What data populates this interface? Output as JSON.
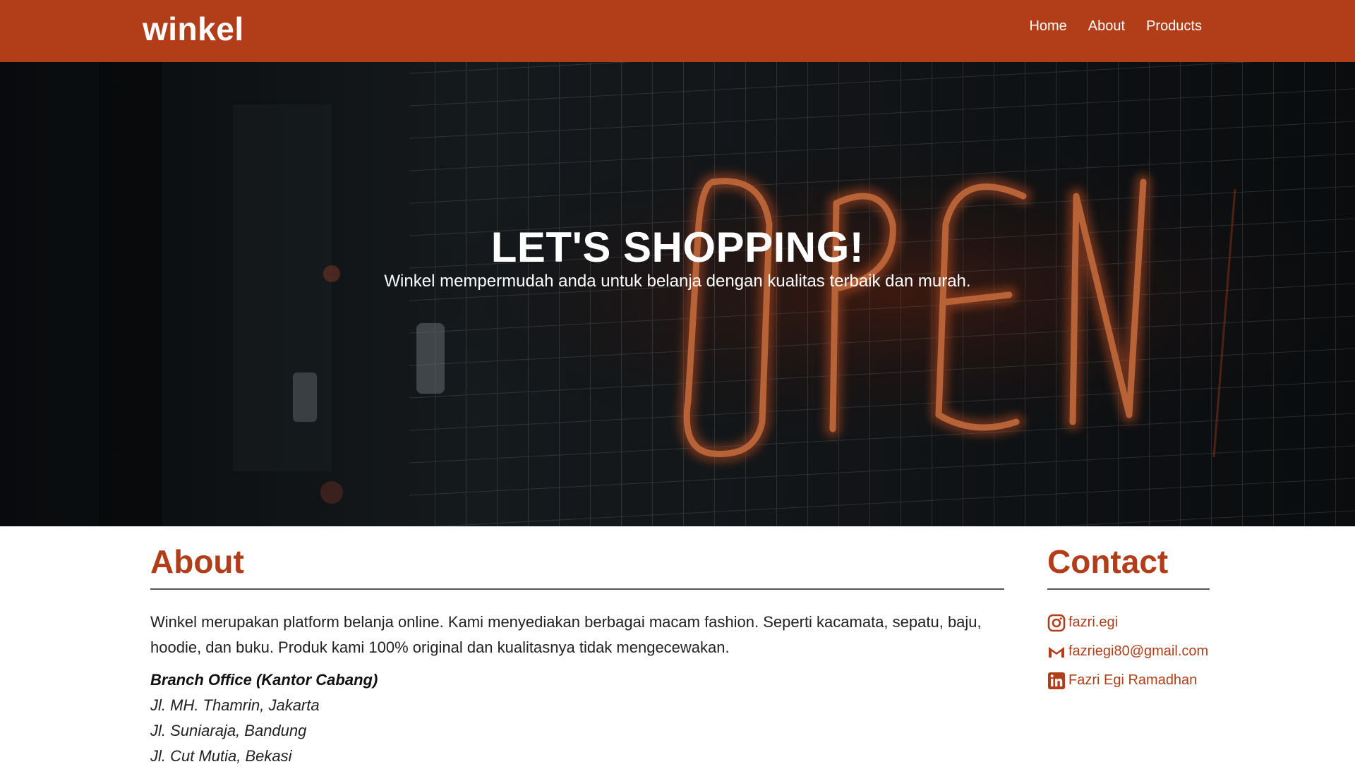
{
  "navbar": {
    "brand": "winkel",
    "links": [
      "Home",
      "About",
      "Products"
    ]
  },
  "hero": {
    "title": "LET'S SHOPPING!",
    "subtitle": "Winkel mempermudah anda untuk belanja dengan kualitas terbaik dan murah.",
    "background_sign_text": "OPEN"
  },
  "about": {
    "heading": "About",
    "description": "Winkel merupakan platform belanja online. Kami menyediakan berbagai macam fashion. Seperti kacamata, sepatu, baju, hoodie, dan buku. Produk kami 100% original dan kualitasnya tidak mengecewakan.",
    "branch_title": "Branch Office (Kantor Cabang)",
    "branches": [
      "Jl. MH. Thamrin, Jakarta",
      "Jl. Suniaraja, Bandung",
      "Jl. Cut Mutia, Bekasi"
    ]
  },
  "contact": {
    "heading": "Contact",
    "items": [
      {
        "icon": "instagram-icon",
        "label": "fazri.egi"
      },
      {
        "icon": "gmail-icon",
        "label": "fazriegi80@gmail.com"
      },
      {
        "icon": "linkedin-icon",
        "label": "Fazri Egi Ramadhan"
      }
    ]
  },
  "colors": {
    "accent": "#b13e19",
    "nav_text": "#ffffff",
    "hero_neon": "#e8622e"
  }
}
